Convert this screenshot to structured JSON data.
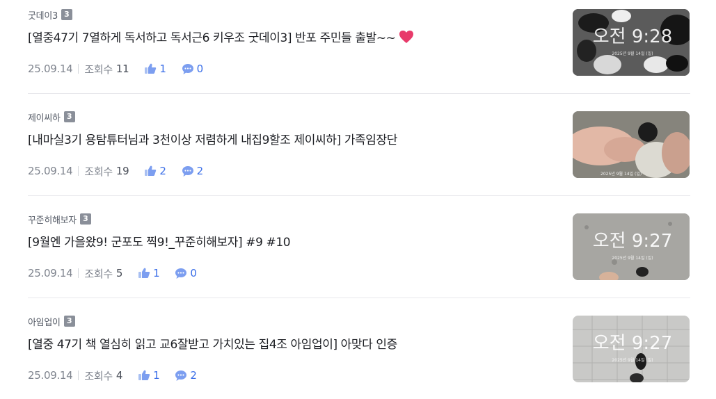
{
  "posts": [
    {
      "author": "굿데이3",
      "level": "3",
      "title": "[열중47기 7열하게 독서하고 독서근6 키우조 굿데이3] 반포 주민들 출발~~",
      "date": "25.09.14",
      "views_label": "조회수",
      "views": "11",
      "likes": "1",
      "comments": "0",
      "thumbnail_time": "오전 9:28",
      "thumbnail_date": "2025년 9월 14일 (일)"
    },
    {
      "author": "제이씨하",
      "level": "3",
      "title": "[내마실3기 용탐튜터님과 3천이상 저렴하게 내집9할조 제이씨하] 가족임장단",
      "date": "25.09.14",
      "views_label": "조회수",
      "views": "19",
      "likes": "2",
      "comments": "2",
      "thumbnail_time": "",
      "thumbnail_date": "2025년 9월 14일 (일)"
    },
    {
      "author": "꾸준히해보자",
      "level": "3",
      "title": "[9월엔 가을왔9! 군포도 찍9!_꾸준히해보자] #9 #10",
      "date": "25.09.14",
      "views_label": "조회수",
      "views": "5",
      "likes": "1",
      "comments": "0",
      "thumbnail_time": "오전 9:27",
      "thumbnail_date": "2025년 9월 14일 (일)"
    },
    {
      "author": "아임업이",
      "level": "3",
      "title": "[열중 47기 책 열심히 읽고 교6잘받고 가치있는 집4조 아임업이] 아맞다 인증",
      "date": "25.09.14",
      "views_label": "조회수",
      "views": "4",
      "likes": "1",
      "comments": "2",
      "thumbnail_time": "오전 9:27",
      "thumbnail_date": "2025년 9월 14일 (일)"
    }
  ],
  "colors": {
    "accent": "#3a6ee8",
    "heart": "#e83a6a",
    "badge": "#8a8f99"
  }
}
